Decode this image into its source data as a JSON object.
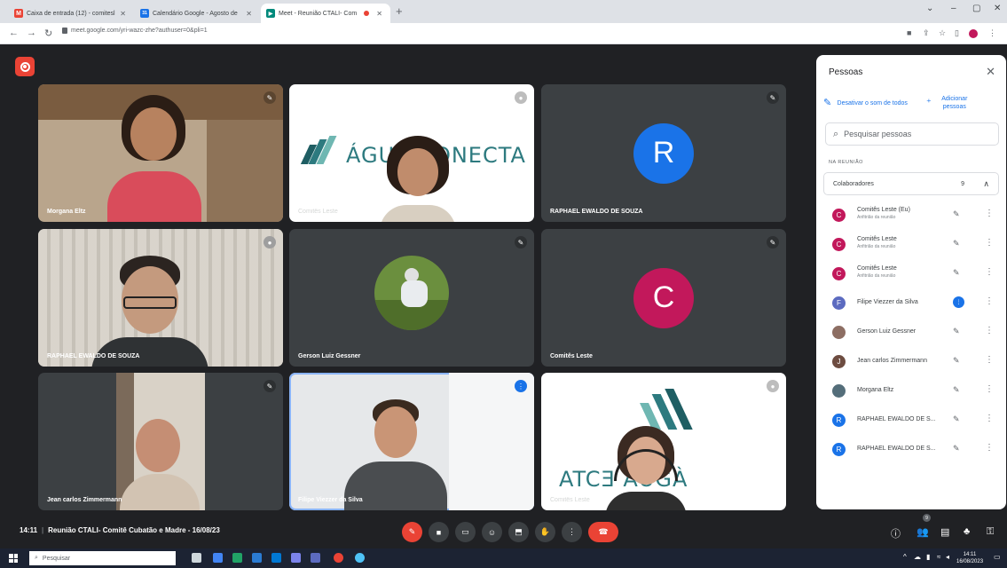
{
  "browser": {
    "tabs": [
      {
        "title": "Caixa de entrada (12) - comitesl",
        "favicon": "gmail-icon",
        "color": "#ea4335",
        "letter": "M"
      },
      {
        "title": "Calendário Google - Agosto de",
        "favicon": "calendar-icon",
        "color": "#1a73e8",
        "letter": "31"
      },
      {
        "title": "Meet - Reunião CTALI- Com",
        "favicon": "meet-icon",
        "color": "#00897b",
        "letter": "▶"
      }
    ],
    "url": "meet.google.com/yri-wazc-zhe?authuser=0&pli=1"
  },
  "tiles": [
    {
      "name": "Morgana Eltz",
      "mic": "muted"
    },
    {
      "name": "Comitês Leste",
      "mic": "idle",
      "logo": "ÁGUA CONECTA"
    },
    {
      "name": "RAPHAEL EWALDO DE SOUZA",
      "mic": "muted",
      "initial": "R",
      "color": "#1a73e8"
    },
    {
      "name": "RAPHAEL EWALDO DE SOUZA",
      "mic": "idle"
    },
    {
      "name": "Gerson Luiz Gessner",
      "mic": "muted"
    },
    {
      "name": "Comitês Leste",
      "mic": "muted",
      "initial": "C",
      "color": "#c2185b"
    },
    {
      "name": "Jean carlos Zimmermann",
      "mic": "muted"
    },
    {
      "name": "Filipe Viezzer da Silva",
      "mic": "speaking"
    },
    {
      "name": "Comitês Leste",
      "mic": "idle",
      "logo": "ATCƎ AUGÀ"
    }
  ],
  "panel": {
    "title": "Pessoas",
    "mute_all": "Desativar o som de todos",
    "add_people": "Adicionar pessoas",
    "search_placeholder": "Pesquisar pessoas",
    "section": "NA REUNIÃO",
    "group": {
      "label": "Colaboradores",
      "count": "9"
    },
    "people": [
      {
        "name": "Comitês Leste (Eu)",
        "sub": "Anfitrião da reunião",
        "initial": "C",
        "color": "#c2185b",
        "mic": "muted"
      },
      {
        "name": "Comitês Leste",
        "sub": "Anfitrião da reunião",
        "initial": "C",
        "color": "#c2185b",
        "mic": "muted"
      },
      {
        "name": "Comitês Leste",
        "sub": "Anfitrião da reunião",
        "initial": "C",
        "color": "#c2185b",
        "mic": "muted"
      },
      {
        "name": "Filipe Viezzer da Silva",
        "sub": "",
        "initial": "F",
        "color": "#5c6bc0",
        "mic": "speaking"
      },
      {
        "name": "Gerson Luiz Gessner",
        "sub": "",
        "initial": "",
        "color": "#8d6e63",
        "mic": "muted"
      },
      {
        "name": "Jean carlos Zimmermann",
        "sub": "",
        "initial": "J",
        "color": "#6d4c41",
        "mic": "muted"
      },
      {
        "name": "Morgana Eltz",
        "sub": "",
        "initial": "",
        "color": "#546e7a",
        "mic": "muted"
      },
      {
        "name": "RAPHAEL EWALDO DE S...",
        "sub": "",
        "initial": "R",
        "color": "#1a73e8",
        "mic": "muted"
      },
      {
        "name": "RAPHAEL EWALDO DE S...",
        "sub": "",
        "initial": "R",
        "color": "#1a73e8",
        "mic": "muted"
      }
    ]
  },
  "footer": {
    "time": "14:11",
    "meeting": "Reunião CTALI- Comitê Cubatão e Madre - 16/08/23",
    "participants_badge": "9"
  },
  "taskbar": {
    "search": "Pesquisar",
    "clock_time": "14:11",
    "clock_date": "16/08/2023"
  }
}
